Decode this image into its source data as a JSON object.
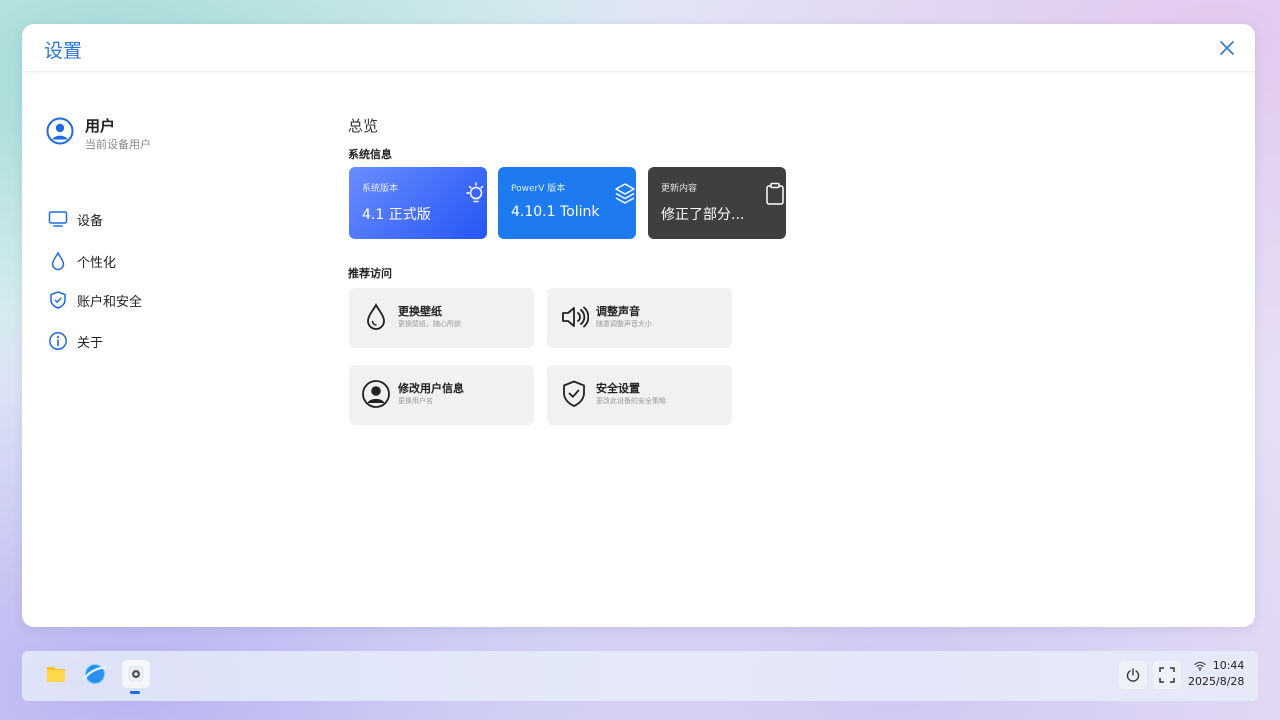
{
  "window": {
    "title": "设置"
  },
  "user": {
    "name": "用户",
    "subtitle": "当前设备用户"
  },
  "nav": {
    "items": [
      {
        "label": "设备",
        "icon": "monitor-icon"
      },
      {
        "label": "个性化",
        "icon": "droplet-icon"
      },
      {
        "label": "账户和安全",
        "icon": "shield-icon"
      },
      {
        "label": "关于",
        "icon": "info-icon"
      }
    ]
  },
  "overview": {
    "title": "总览",
    "system_info_title": "系统信息",
    "cards": [
      {
        "label": "系统版本",
        "value": "4.1 正式版",
        "icon": "lightbulb-icon",
        "color": "#2f5ff5"
      },
      {
        "label": "PowerV  版本",
        "value": "4.10.1  Tolink",
        "icon": "layers-icon",
        "color": "#1e7bef"
      },
      {
        "label": "更新内容",
        "value": "修正了部分...",
        "icon": "clipboard-icon",
        "color": "#3f3f3f"
      }
    ],
    "recommend_title": "推荐访问",
    "quick": [
      {
        "title": "更换壁纸",
        "subtitle": "更换壁纸，随心所欲",
        "icon": "droplet-icon"
      },
      {
        "title": "调整声音",
        "subtitle": "随意调整声音大小",
        "icon": "speaker-icon"
      },
      {
        "title": "修改用户信息",
        "subtitle": "更换用户名",
        "icon": "user-circle-icon"
      },
      {
        "title": "安全设置",
        "subtitle": "更改此设备的安全策略",
        "icon": "shield-check-icon"
      }
    ]
  },
  "taskbar": {
    "apps": [
      "folder-icon",
      "browser-icon",
      "settings-icon"
    ],
    "time": "10:44",
    "date": "2025/8/28"
  },
  "colors": {
    "accent": "#1e6be0",
    "title": "#2b74d8"
  }
}
